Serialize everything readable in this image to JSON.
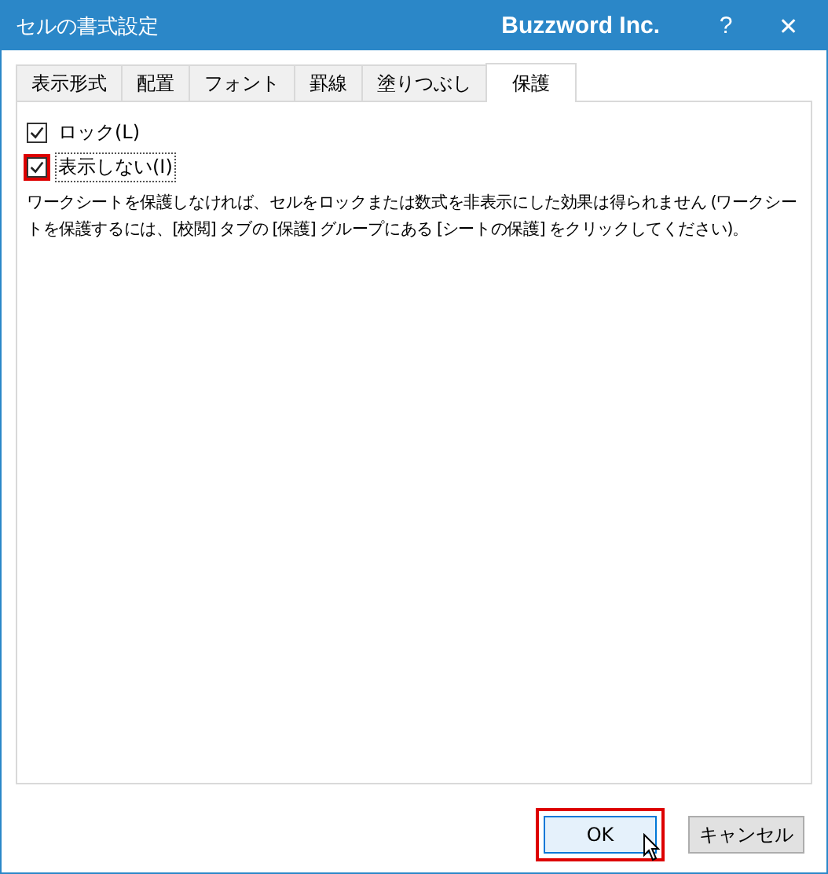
{
  "window": {
    "title": "セルの書式設定",
    "brand": "Buzzword Inc.",
    "help": "?",
    "close": "✕"
  },
  "tabs": [
    {
      "label": "表示形式",
      "selected": false
    },
    {
      "label": "配置",
      "selected": false
    },
    {
      "label": "フォント",
      "selected": false
    },
    {
      "label": "罫線",
      "selected": false
    },
    {
      "label": "塗りつぶし",
      "selected": false
    },
    {
      "label": "保護",
      "selected": true
    }
  ],
  "options": [
    {
      "label": "ロック(L)",
      "checked": true,
      "highlighted": false
    },
    {
      "label": "表示しない(I)",
      "checked": true,
      "highlighted": true
    }
  ],
  "note": "ワークシートを保護しなければ、セルをロックまたは数式を非表示にした効果は得られません (ワークシートを保護するには、[校閲] タブの [保護] グループにある [シートの保護] をクリックしてください)。",
  "buttons": [
    {
      "label": "OK",
      "default": true,
      "highlighted": true
    },
    {
      "label": "キャンセル",
      "default": false,
      "highlighted": false
    }
  ]
}
